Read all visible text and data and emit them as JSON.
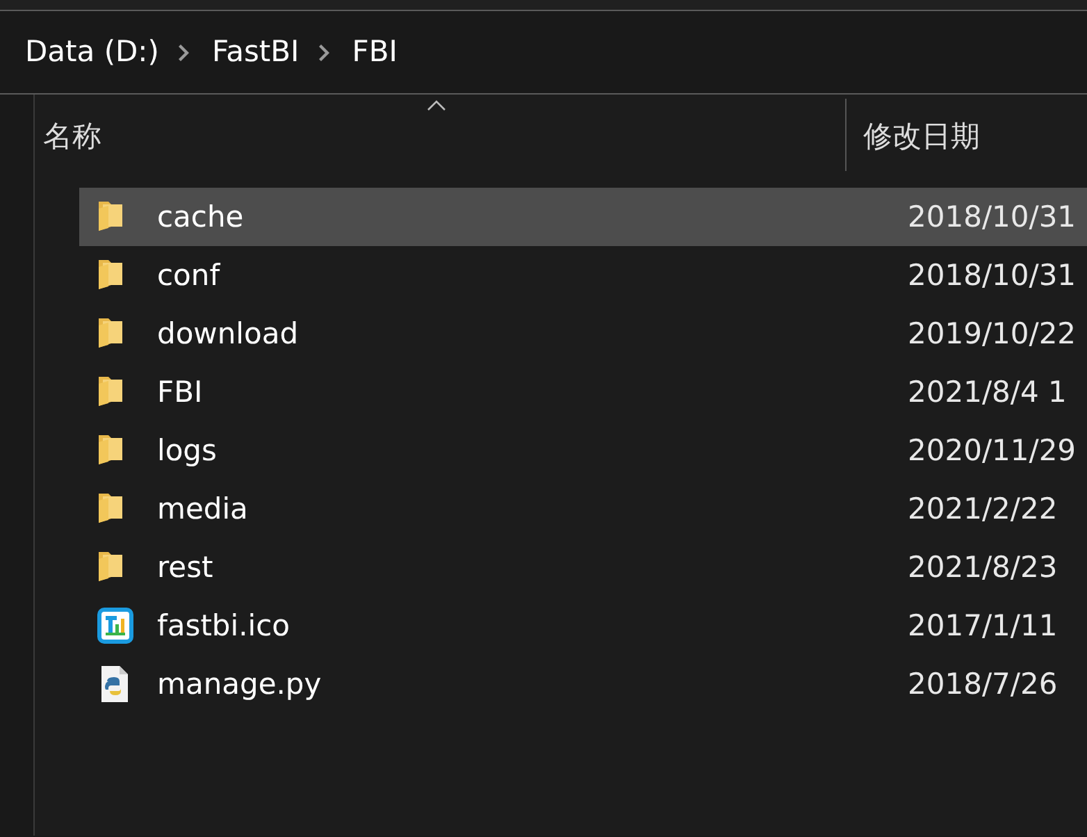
{
  "breadcrumb": [
    "Data (D:)",
    "FastBI",
    "FBI"
  ],
  "columns": [
    {
      "label": "名称",
      "sorted": true
    },
    {
      "label": "修改日期",
      "sorted": false
    }
  ],
  "files": [
    {
      "name": "cache",
      "kind": "folder",
      "date": "2018/10/31",
      "selected": true
    },
    {
      "name": "conf",
      "kind": "folder",
      "date": "2018/10/31",
      "selected": false
    },
    {
      "name": "download",
      "kind": "folder",
      "date": "2019/10/22",
      "selected": false
    },
    {
      "name": "FBI",
      "kind": "folder",
      "date": "2021/8/4 1",
      "selected": false
    },
    {
      "name": "logs",
      "kind": "folder",
      "date": "2020/11/29",
      "selected": false
    },
    {
      "name": "media",
      "kind": "folder",
      "date": "2021/2/22",
      "selected": false
    },
    {
      "name": "rest",
      "kind": "folder",
      "date": "2021/8/23",
      "selected": false
    },
    {
      "name": "fastbi.ico",
      "kind": "icon",
      "date": "2017/1/11",
      "selected": false
    },
    {
      "name": "manage.py",
      "kind": "python",
      "date": "2018/7/26",
      "selected": false
    }
  ]
}
